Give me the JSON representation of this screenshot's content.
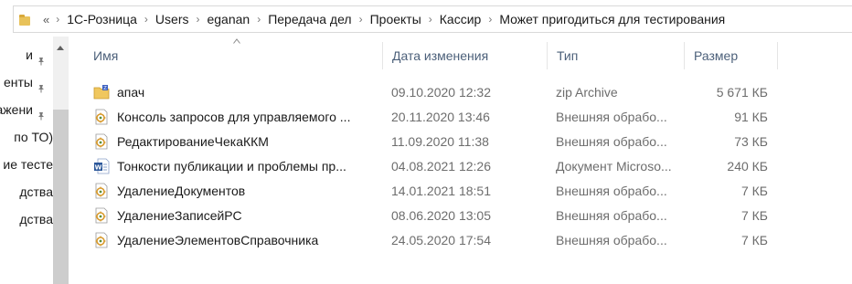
{
  "address": {
    "overflow": "«",
    "crumbs": [
      "1С-Розница",
      "Users",
      "eganan",
      "Передача дел",
      "Проекты",
      "Кассир",
      "Может пригодиться для тестирования"
    ]
  },
  "nav": {
    "items": [
      {
        "label": "и",
        "pinned": true
      },
      {
        "label": "енты",
        "pinned": true
      },
      {
        "label": "ажени",
        "pinned": true
      },
      {
        "label": "по ТО)",
        "pinned": false
      },
      {
        "label": "ие тесте",
        "pinned": false
      },
      {
        "label": "дства",
        "pinned": false
      },
      {
        "label": "дства",
        "pinned": false
      }
    ]
  },
  "columns": {
    "name": "Имя",
    "date": "Дата изменения",
    "type": "Тип",
    "size": "Размер"
  },
  "files": [
    {
      "name": "апач",
      "date": "09.10.2020 12:32",
      "type": "zip Archive",
      "size": "5 671 КБ",
      "icon": "zip-archive-icon"
    },
    {
      "name": "Консоль запросов для управляемого ...",
      "date": "20.11.2020 13:46",
      "type": "Внешняя обрабо...",
      "size": "91 КБ",
      "icon": "external-processing-icon"
    },
    {
      "name": "РедактированиеЧекаККМ",
      "date": "11.09.2020 11:38",
      "type": "Внешняя обрабо...",
      "size": "73 КБ",
      "icon": "external-processing-icon"
    },
    {
      "name": "Тонкости публикации и проблемы пр...",
      "date": "04.08.2021 12:26",
      "type": "Документ Microso...",
      "size": "240 КБ",
      "icon": "word-document-icon"
    },
    {
      "name": "УдалениеДокументов",
      "date": "14.01.2021 18:51",
      "type": "Внешняя обрабо...",
      "size": "7 КБ",
      "icon": "external-processing-icon"
    },
    {
      "name": "УдалениеЗаписейРС",
      "date": "08.06.2020 13:05",
      "type": "Внешняя обрабо...",
      "size": "7 КБ",
      "icon": "external-processing-icon"
    },
    {
      "name": "УдалениеЭлементовСправочника",
      "date": "24.05.2020 17:54",
      "type": "Внешняя обрабо...",
      "size": "7 КБ",
      "icon": "external-processing-icon"
    }
  ],
  "colors": {
    "header_text": "#4c607a",
    "meta_text": "#6d6d6d",
    "folder": "#e8c25a"
  }
}
